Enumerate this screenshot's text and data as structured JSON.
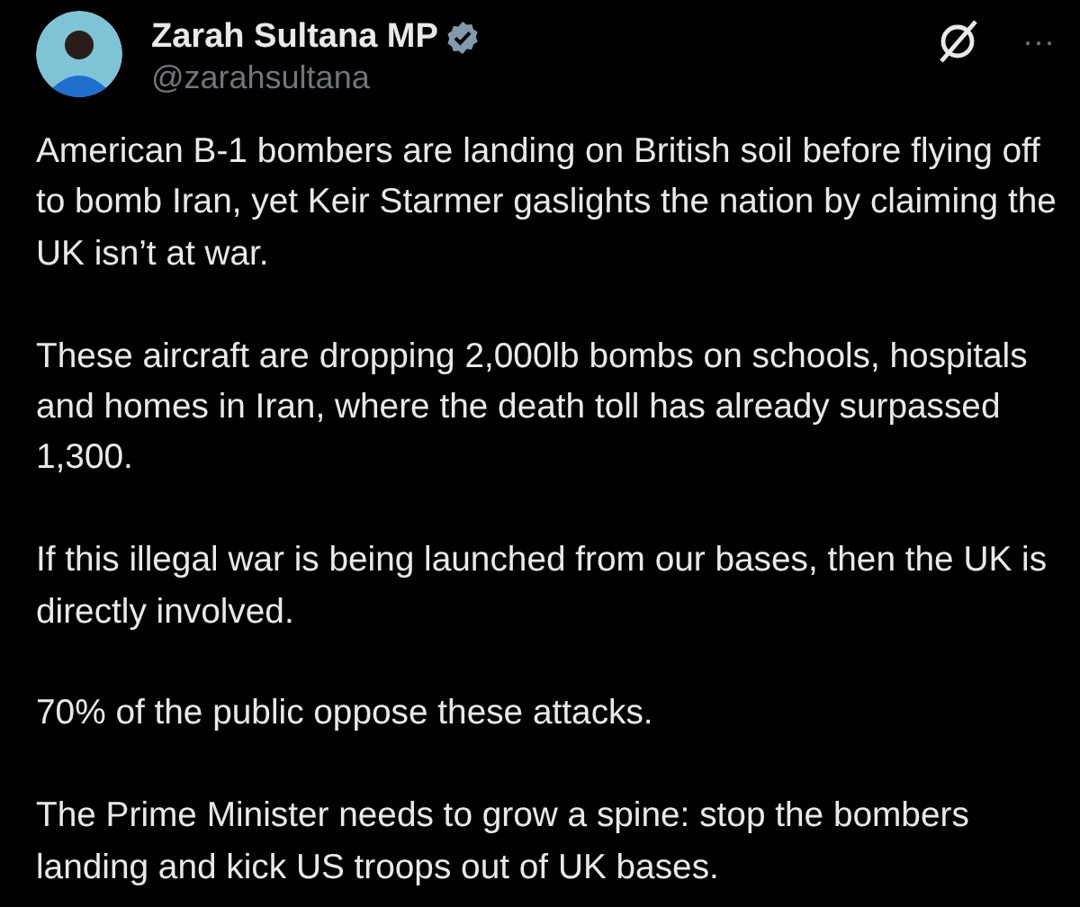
{
  "author": {
    "name": "Zarah Sultana MP",
    "handle": "@zarahsultana"
  },
  "more_menu": "···",
  "paragraphs": [
    "American B-1 bombers are landing on British soil before flying off to bomb Iran, yet Keir Starmer gaslights the nation by claiming the UK isn’t at war.",
    "These aircraft are dropping 2,000lb bombs on schools, hospitals and homes in Iran, where the death toll has already surpassed 1,300.",
    "If this illegal war is being launched from our bases, then the UK is directly involved.",
    "70% of the public oppose these attacks.",
    "The Prime Minister needs to grow a spine: stop the bombers landing and kick US troops out of UK bases."
  ]
}
